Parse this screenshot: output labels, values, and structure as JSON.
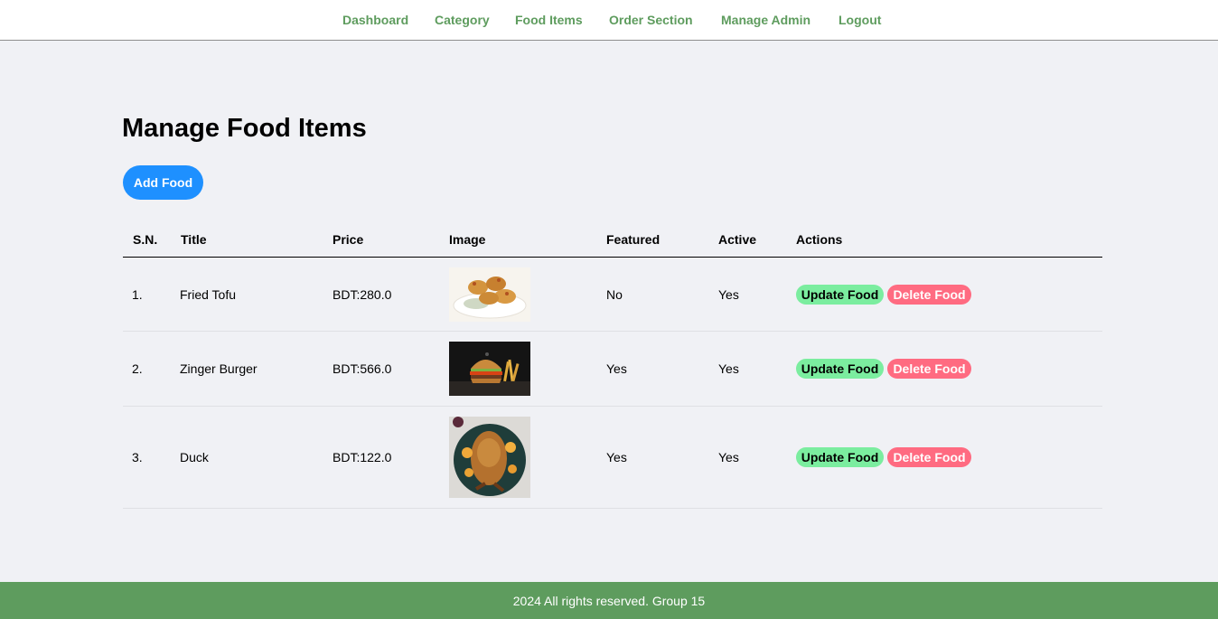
{
  "nav": {
    "items": [
      {
        "label": "Dashboard"
      },
      {
        "label": "Category"
      },
      {
        "label": "Food Items"
      },
      {
        "label": "Order Section"
      },
      {
        "label": "Manage Admin"
      },
      {
        "label": "Logout"
      }
    ]
  },
  "main": {
    "title": "Manage Food Items",
    "add_button": "Add Food"
  },
  "table": {
    "columns": [
      "S.N.",
      "Title",
      "Price",
      "Image",
      "Featured",
      "Active",
      "Actions"
    ],
    "rows": [
      {
        "sn": "1.",
        "title": "Fried Tofu",
        "price": "BDT:280.0",
        "image_icon": "fried-tofu-photo",
        "featured": "No",
        "active": "Yes",
        "update_label": "Update Food",
        "delete_label": "Delete Food"
      },
      {
        "sn": "2.",
        "title": "Zinger Burger",
        "price": "BDT:566.0",
        "image_icon": "zinger-burger-photo",
        "featured": "Yes",
        "active": "Yes",
        "update_label": "Update Food",
        "delete_label": "Delete Food"
      },
      {
        "sn": "3.",
        "title": "Duck",
        "price": "BDT:122.0",
        "image_icon": "roast-duck-photo",
        "featured": "Yes",
        "active": "Yes",
        "update_label": "Update Food",
        "delete_label": "Delete Food"
      }
    ]
  },
  "footer": {
    "text": "2024 All rights reserved. Group 15"
  },
  "colors": {
    "nav_link": "#5e9c5e",
    "footer_bg": "#5e9c5e",
    "add_button": "#1e90ff",
    "update_button": "#7bed9f",
    "delete_button": "#ff6b81",
    "page_bg": "#f0f1f5"
  }
}
